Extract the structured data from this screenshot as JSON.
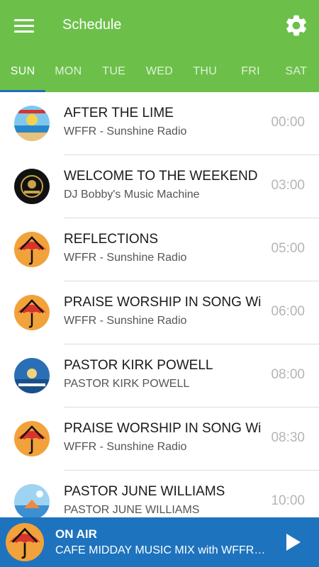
{
  "app": {
    "title": "Schedule",
    "menu_icon": "hamburger-menu-icon",
    "settings_icon": "gear-icon"
  },
  "colors": {
    "appbar": "#6cc04a",
    "tab_indicator": "#1e6fb8",
    "player": "#1e73be"
  },
  "tabs": [
    {
      "label": "SUN",
      "active": true
    },
    {
      "label": "MON",
      "active": false
    },
    {
      "label": "TUE",
      "active": false
    },
    {
      "label": "WED",
      "active": false
    },
    {
      "label": "THU",
      "active": false
    },
    {
      "label": "FRI",
      "active": false
    },
    {
      "label": "SAT",
      "active": false
    }
  ],
  "schedule": [
    {
      "title": "AFTER THE LIME",
      "host": "WFFR - Sunshine Radio",
      "time": "00:00",
      "thumb": "beach-logo"
    },
    {
      "title": "WELCOME TO THE WEEKEND W",
      "host": "DJ Bobby's Music Machine",
      "time": "03:00",
      "thumb": "dj-logo"
    },
    {
      "title": "REFLECTIONS",
      "host": "WFFR - Sunshine Radio",
      "time": "05:00",
      "thumb": "umbrella-logo"
    },
    {
      "title": "PRAISE WORSHIP IN SONG Wit",
      "host": "WFFR - Sunshine Radio",
      "time": "06:00",
      "thumb": "umbrella-logo"
    },
    {
      "title": "PASTOR KIRK POWELL",
      "host": "PASTOR KIRK POWELL",
      "time": "08:00",
      "thumb": "praise-logo"
    },
    {
      "title": "PRAISE WORSHIP IN SONG Wit",
      "host": "WFFR - Sunshine Radio",
      "time": "08:30",
      "thumb": "umbrella-logo"
    },
    {
      "title": "PASTOR JUNE WILLIAMS",
      "host": "PASTOR JUNE WILLIAMS",
      "time": "10:00",
      "thumb": "sky-logo"
    }
  ],
  "player": {
    "status": "ON AIR",
    "now_playing": "CAFE MIDDAY MUSIC MIX with WFFR - Sunshine Radio",
    "play_icon": "play-icon"
  }
}
